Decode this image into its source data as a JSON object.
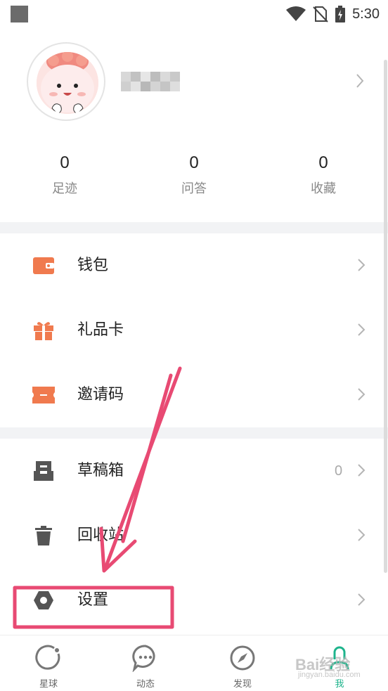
{
  "status_bar": {
    "time": "5:30"
  },
  "profile": {
    "stats": [
      {
        "value": "0",
        "label": "足迹"
      },
      {
        "value": "0",
        "label": "问答"
      },
      {
        "value": "0",
        "label": "收藏"
      }
    ]
  },
  "menu": {
    "group1": [
      {
        "label": "钱包",
        "icon": "wallet-icon"
      },
      {
        "label": "礼品卡",
        "icon": "gift-icon"
      },
      {
        "label": "邀请码",
        "icon": "ticket-icon"
      }
    ],
    "group2": [
      {
        "label": "草稿箱",
        "icon": "drafts-icon",
        "count": "0"
      },
      {
        "label": "回收站",
        "icon": "trash-icon"
      },
      {
        "label": "设置",
        "icon": "settings-hexagon-icon"
      }
    ]
  },
  "bottom_nav": [
    {
      "label": "星球",
      "icon": "planet-ring-icon",
      "active": false
    },
    {
      "label": "动态",
      "icon": "chat-bubble-icon",
      "active": false
    },
    {
      "label": "发现",
      "icon": "compass-icon",
      "active": false
    },
    {
      "label": "我",
      "icon": "profile-icon",
      "active": true
    }
  ],
  "colors": {
    "accent_orange": "#f07a4e",
    "icon_gray": "#555555",
    "active_green": "#1eb48c",
    "annotation_pink": "#e84a73"
  },
  "watermark": {
    "text": "Bai经验",
    "sub": "jingyan.baidu.com"
  }
}
